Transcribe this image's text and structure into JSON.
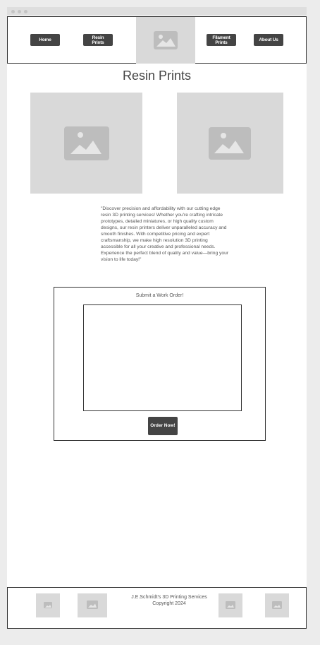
{
  "nav": {
    "home_label": "Home",
    "resin_label": "Resin Prints",
    "filament_label": "Filament Prints",
    "about_label": "About Us"
  },
  "page": {
    "title": "Resin Prints",
    "description": "\"Discover precision and affordability with our cutting edge resin 3D printing services! Whether you're crafting intricate prototypes, detailed miniatures, or high quality custom designs, our resin printers deliver unparalleled accuracy and smooth finishes. With competitive pricing and expert craftsmanship, we make high resolution 3D printing accessible for all your creative and professional needs. Experience the perfect blend of quality and value—bring your vision to life today!\""
  },
  "form": {
    "title": "Submit a Work Order!",
    "order_label": "Order Now!"
  },
  "footer": {
    "company": "J.E.Schmidt's 3D Printing Services",
    "copyright": "Copyright 2024"
  },
  "icons": {
    "placeholder": "image-placeholder-icon"
  },
  "colors": {
    "button": "#444444",
    "placeholder": "#d9d9d9",
    "icon": "#bdbdbd"
  }
}
